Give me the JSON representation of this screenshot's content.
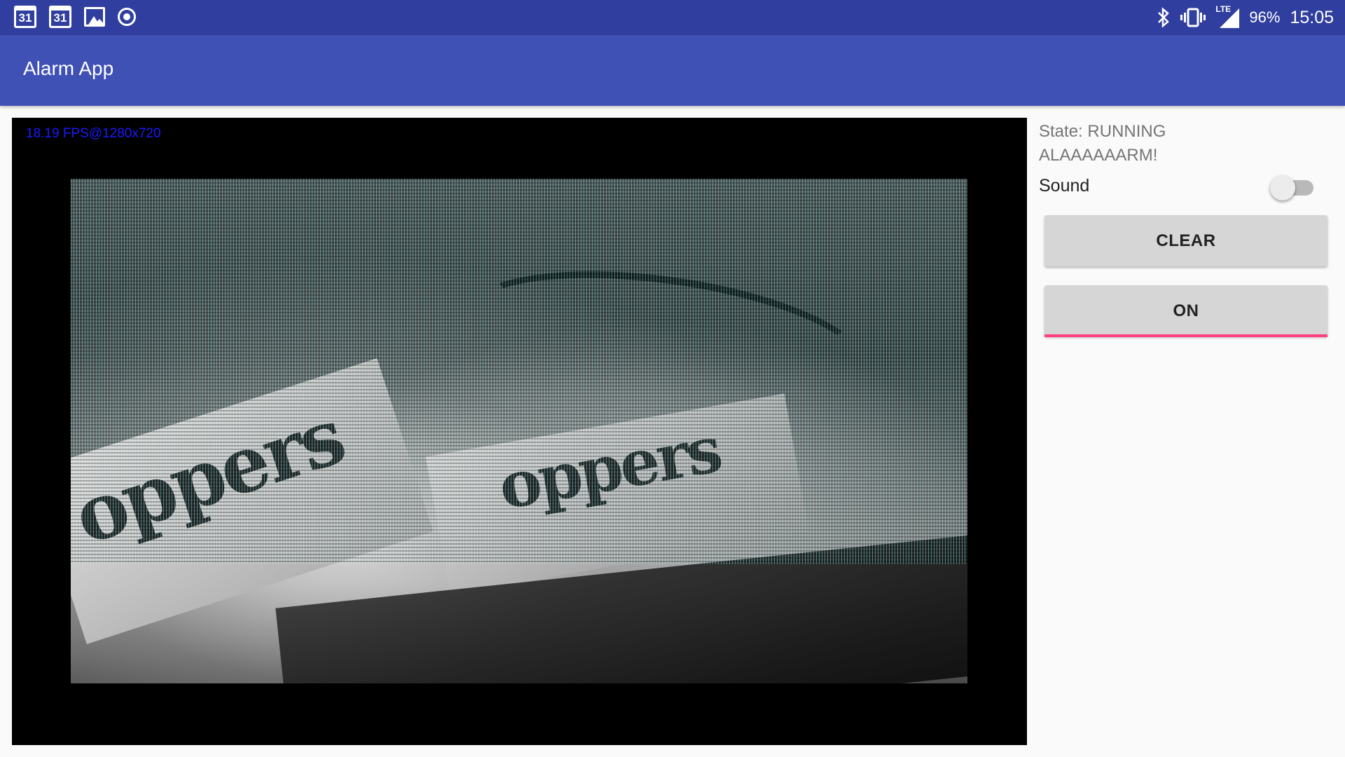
{
  "status_bar": {
    "left_icons": [
      {
        "icon": "calendar-icon",
        "text": "31"
      },
      {
        "icon": "calendar-icon",
        "text": "31"
      },
      {
        "icon": "image-icon"
      },
      {
        "icon": "record-icon"
      }
    ],
    "right_icons": [
      "bluetooth-icon",
      "vibrate-icon",
      "lte-signal-icon"
    ],
    "network": "LTE",
    "battery": "96%",
    "time": "15:05"
  },
  "app_bar": {
    "title": "Alarm App",
    "color": "#3f51b5"
  },
  "preview": {
    "fps_text": "18.19 FPS@1280x720",
    "fps_color": "#1a1aff",
    "feed_brand_text": "oppers"
  },
  "panel": {
    "state_line1": "State: RUNNING",
    "state_line2": "ALAAAAAARM!",
    "sound_label": "Sound",
    "sound_enabled": false,
    "clear_button": "CLEAR",
    "on_button": "ON",
    "accent": "#ff4081"
  }
}
